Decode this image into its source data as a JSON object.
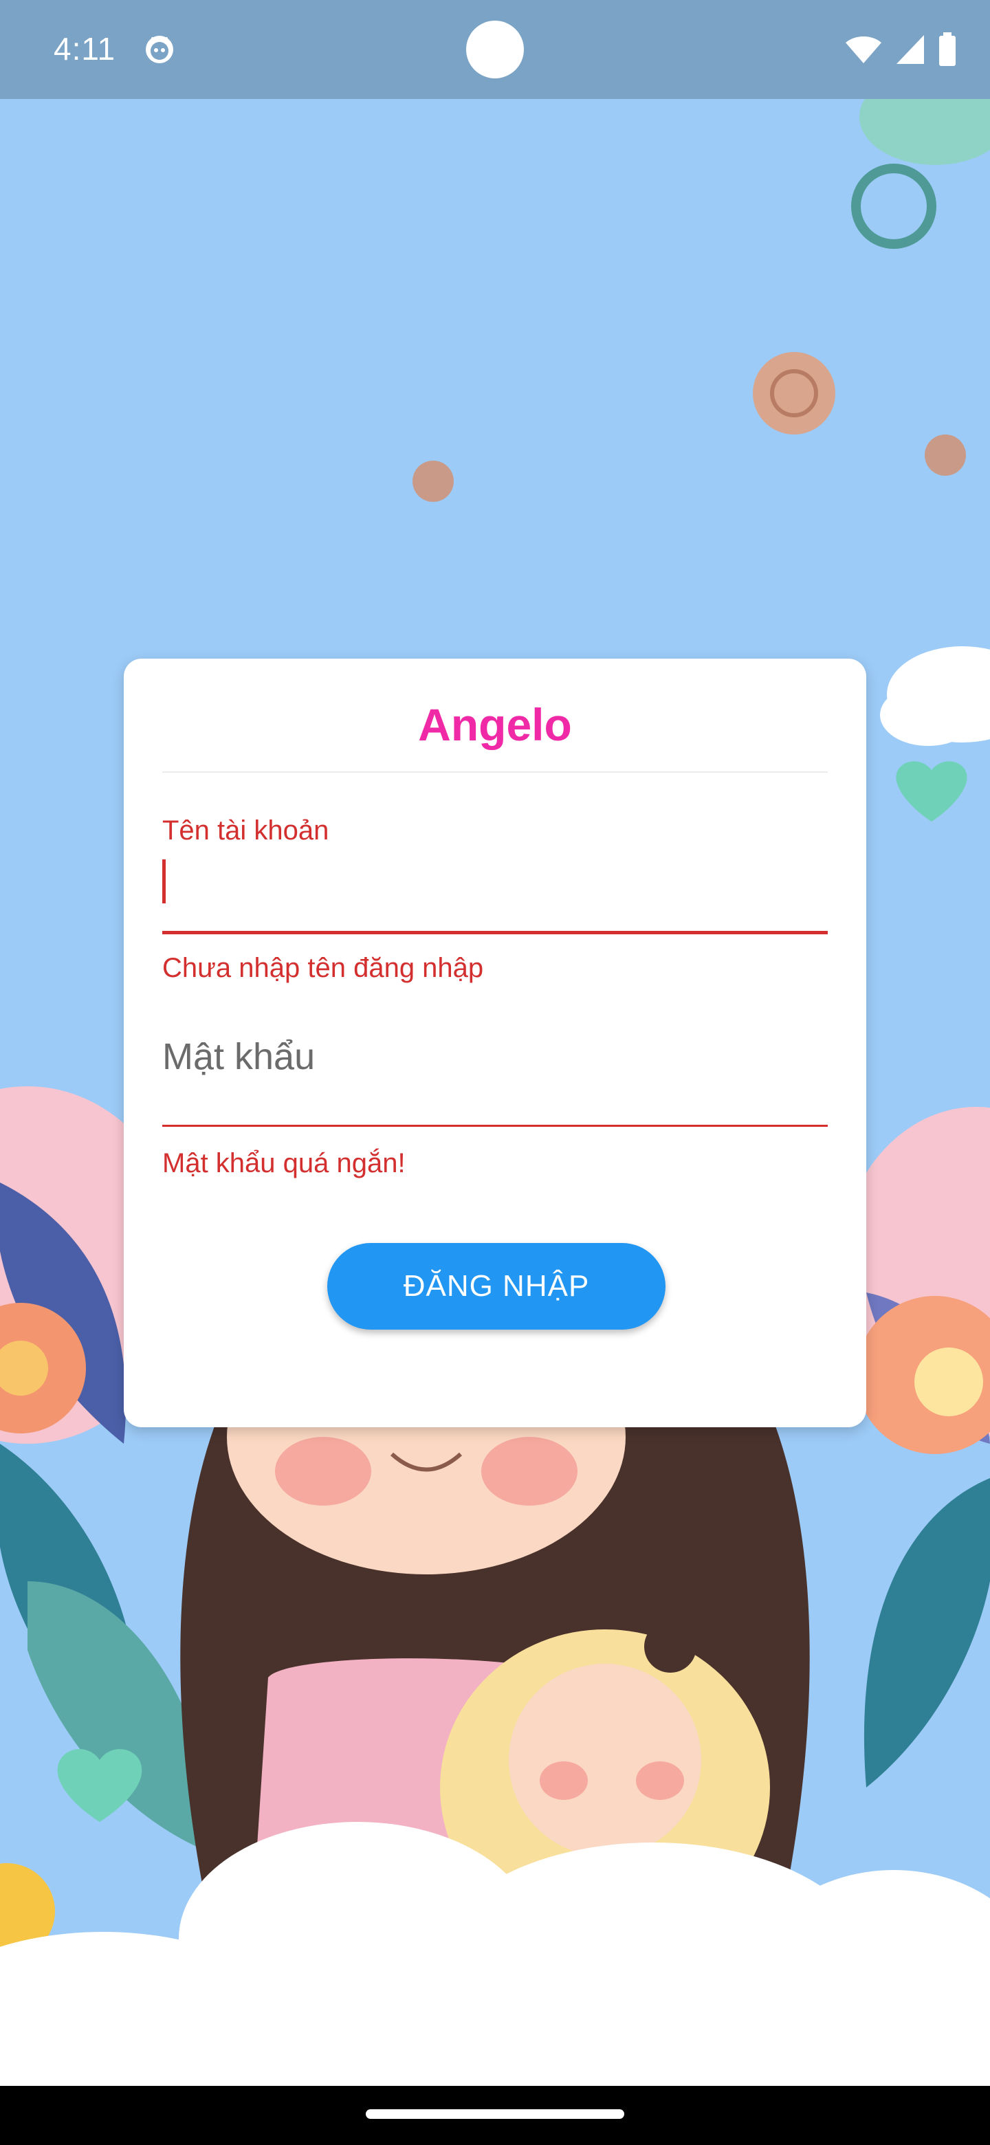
{
  "status_bar": {
    "time": "4:11",
    "app_icon": "android-face-icon",
    "wifi_icon": "wifi-icon",
    "signal_icon": "cellular-signal-icon",
    "battery_icon": "battery-icon"
  },
  "login_card": {
    "title": "Angelo",
    "username": {
      "label": "Tên tài khoản",
      "value": "",
      "error": "Chưa nhập tên đăng nhập"
    },
    "password": {
      "placeholder": "Mật khẩu",
      "value": "",
      "error": "Mật khẩu quá ngắn!"
    },
    "login_button_label": "ĐĂNG NHẬP"
  },
  "colors": {
    "title": "#f02aa6",
    "error": "#d32f2f",
    "button": "#2196f3",
    "background_sky": "#9ccbf7"
  }
}
